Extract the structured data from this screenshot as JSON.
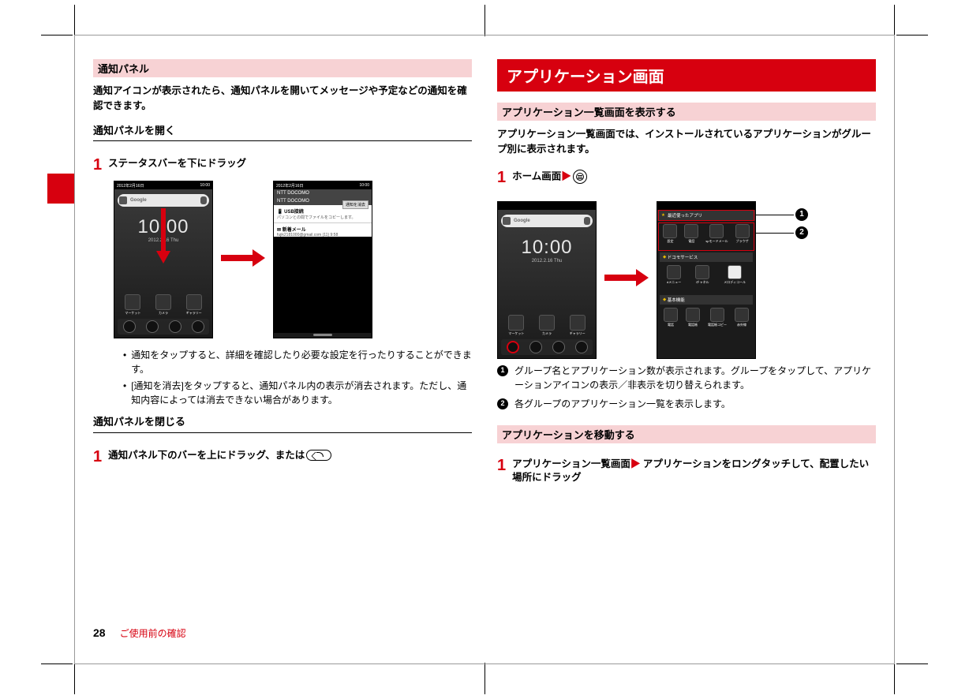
{
  "left": {
    "heading_notif_panel": "通知パネル",
    "body1": "通知アイコンが表示されたら、通知パネルを開いてメッセージや予定などの通知を確認できます。",
    "open_panel": "通知パネルを開く",
    "step1": "ステータスバーを下にドラッグ",
    "phone_sbar_date": "2012年2月16日",
    "phone_sbar_time": "10:00",
    "clock_time": "10:00",
    "clock_date": "2012.2.16 Thu",
    "gbar_label": "Google",
    "np_carrier": "NTT DOCOMO",
    "np_clear": "通知を消去",
    "np_row1_title": "USB接続",
    "np_row1_sub": "パソコンとの間でファイルをコピーします。",
    "np_row2_title": "新着メール",
    "np_row2_sub": "fujik2181000@gmail.com (11)        9:58",
    "bullet1": "通知をタップすると、詳細を確認したり必要な設定を行ったりすることができます。",
    "bullet2": "[通知を消去]をタップすると、通知パネル内の表示が消去されます。ただし、通知内容によっては消去できない場合があります。",
    "close_panel": "通知パネルを閉じる",
    "step2_a": "通知パネル下のバーを上にドラッグ、または",
    "dock_market": "マーケット",
    "dock_camera": "カメラ",
    "dock_gallery": "ギャラリー"
  },
  "right": {
    "big_heading": "アプリケーション画面",
    "sub1": "アプリケーション一覧画面を表示する",
    "body1": "アプリケーション一覧画面では、インストールされているアプリケーションがグループ別に表示されます。",
    "step1_a": "ホーム画面",
    "as_tab": "最近使ったアプリ",
    "as_sep2": "ドコモサービス",
    "as_sep3": "基本機能",
    "grid1": {
      "a": "設定",
      "b": "電話",
      "c": "spモードメール",
      "d": "ブラウザ"
    },
    "grid2": {
      "a": "dメニュー",
      "b": "iチャネル",
      "c": "メロディコール"
    },
    "grid3": {
      "a": "電話",
      "b": "電話帳",
      "c": "電話帳コピー",
      "d": "赤外線"
    },
    "annot1": "グループ名とアプリケーション数が表示されます。グループをタップして、アプリケーションアイコンの表示／非表示を切り替えられます。",
    "annot2": "各グループのアプリケーション一覧を表示します。",
    "sub2": "アプリケーションを移動する",
    "step2_a": "アプリケーション一覧画面",
    "step2_b": " アプリケーションをロングタッチして、配置したい場所にドラッグ",
    "callout1": "1",
    "callout2": "2"
  },
  "footer": {
    "page": "28",
    "section": "ご使用前の確認"
  }
}
